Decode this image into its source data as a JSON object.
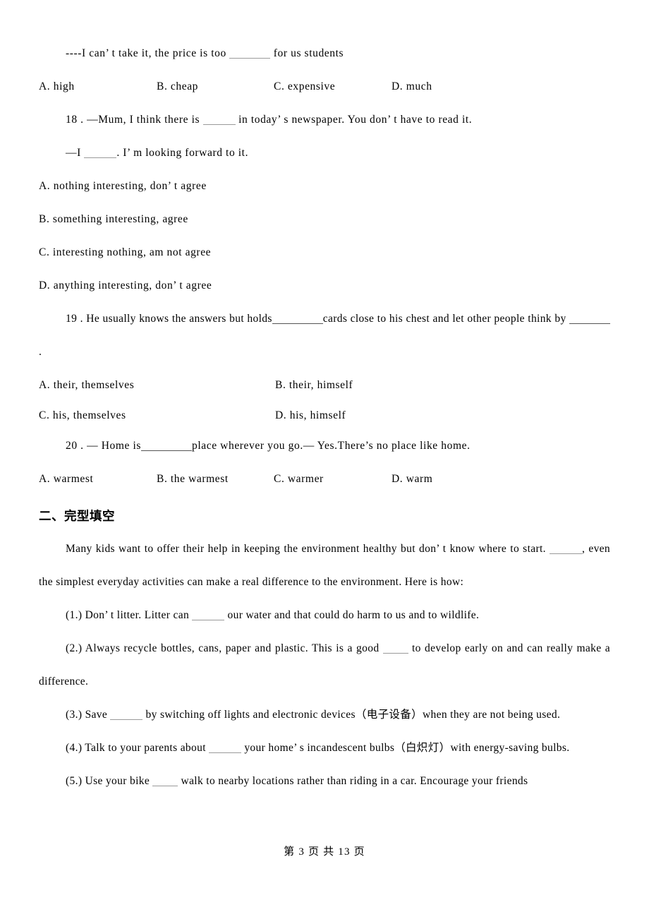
{
  "document": {
    "page_footer": "第 3 页 共 13 页"
  },
  "questions": {
    "q17_continuation": {
      "stem_before": "----I can’ t take it, the price is too ",
      "stem_after": " for us students",
      "options": [
        "A. high",
        "B. cheap",
        "C. expensive",
        "D. much"
      ]
    },
    "q18": {
      "stem_line1_before": "18 . —Mum, I think there is ",
      "stem_line1_after": " in today’ s newspaper. You don’ t have to read it.",
      "stem_line2_before": "—I ",
      "stem_line2_after": ". I’ m looking forward to it.",
      "options": [
        "A. nothing interesting, don’ t agree",
        "B. something interesting, agree",
        "C. interesting nothing, am not agree",
        "D. anything interesting, don’ t agree"
      ]
    },
    "q19": {
      "stem_part1": "19 . He usually knows the answers but holds",
      "stem_part2": "cards close to his chest and let other people think by",
      "stem_part3": ".",
      "options": [
        "A. their, themselves",
        "B. their, himself",
        "C. his, themselves",
        "D. his, himself"
      ]
    },
    "q20": {
      "stem_before": "20 . — Home is",
      "stem_after": "place wherever you go.— Yes.There’s no place like home.",
      "options": [
        "A. warmest",
        "B. the warmest",
        "C. warmer",
        "D. warm"
      ]
    }
  },
  "section_two": {
    "heading": "二、完型填空",
    "intro_part1": "Many kids want to offer their help in keeping the environment healthy but don’ t know where to start. ",
    "intro_part2": ", even the simplest everyday activities can make a real difference to the environment. Here is how:",
    "items": [
      {
        "label": "(1.)",
        "text_before": "(1.) Don’ t litter. Litter can ",
        "text_after": " our water and that could do harm to us and to wildlife."
      },
      {
        "label": "(2.)",
        "text_before": "(2.) Always recycle bottles, cans, paper and plastic. This is a good ",
        "text_after": " to develop early on and can really make a difference."
      },
      {
        "label": "(3.)",
        "text_before": "(3.) Save ",
        "text_after": " by switching off lights and electronic devices（电子设备）when they are not being used."
      },
      {
        "label": "(4.)",
        "text_before": "(4.) Talk to your parents about ",
        "text_after": " your home’ s incandescent bulbs（白炽灯）with energy-saving bulbs."
      },
      {
        "label": "(5.)",
        "text_before": "(5.) Use your bike ",
        "text_after": " walk to nearby locations rather than riding in a car. Encourage your friends"
      }
    ]
  }
}
